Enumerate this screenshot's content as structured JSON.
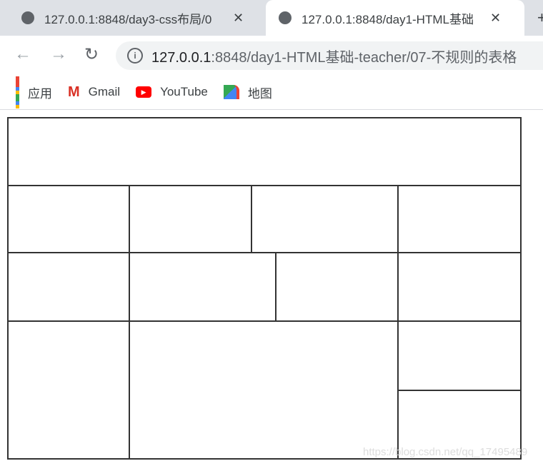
{
  "tabs": [
    {
      "title": "127.0.0.1:8848/day3-css布局/0",
      "close": "✕"
    },
    {
      "title": "127.0.0.1:8848/day1-HTML基础",
      "close": "✕"
    }
  ],
  "new_tab": "+",
  "address": {
    "host": "127.0.0.1",
    "rest": ":8848/day1-HTML基础-teacher/07-不规则的表格"
  },
  "bookmarks": [
    {
      "label": "应用",
      "icon": "apps-grid-icon"
    },
    {
      "label": "Gmail",
      "icon": "gmail-icon"
    },
    {
      "label": "YouTube",
      "icon": "youtube-icon"
    },
    {
      "label": "地图",
      "icon": "maps-icon"
    }
  ],
  "watermark": "https://blog.csdn.net/qq_17495489"
}
